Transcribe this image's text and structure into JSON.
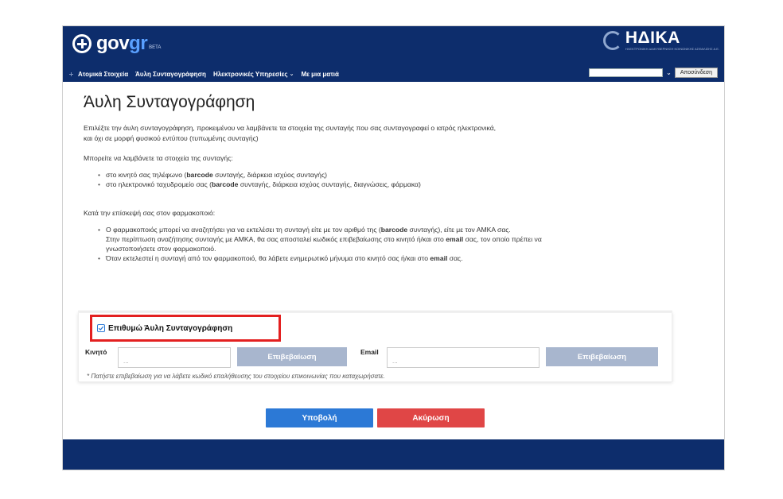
{
  "header": {
    "logo_main": "gov",
    "logo_accent": "gr",
    "logo_beta": "BETA",
    "partner_name": "ΗΔΙΚΑ",
    "partner_sub": "ΗΛΕΚΤΡΟΝΙΚΗ ΔΙΑΚΥΒΕΡΝΗΣΗ ΚΟΙΝΩΝΙΚΗΣ ΑΣΦΑΛΙΣΗΣ Α.Ε.",
    "nav": [
      "Ατομικά Στοιχεία",
      "Άυλη Συνταγογράφηση",
      "Ηλεκτρονικές Υπηρεσίες",
      "Με μια ματιά"
    ],
    "logout_label": "Αποσύνδεση"
  },
  "main": {
    "title": "Άυλη Συνταγογράφηση",
    "intro_1": "Επιλέξτε την άυλη συνταγογράφηση, προκειμένου να λαμβάνετε τα στοιχεία της συνταγής που σας συνταγογραφεί ο ιατρός ηλεκτρονικά,",
    "intro_2": "και όχι σε μορφή φυσικού εντύπου (τυπωμένης συνταγής)",
    "receive_title": "Μπορείτε να λαμβάνετε τα στοιχεία της συνταγής:",
    "receive_1_pre": "στο κινητό σας τηλέφωνο (",
    "receive_1_bold": "barcode",
    "receive_1_post": " συνταγής, διάρκεια ισχύος συνταγής)",
    "receive_2_pre": "στο ηλεκτρονικό ταχυδρομείο σας (",
    "receive_2_bold": "barcode",
    "receive_2_post": " συνταγής, διάρκεια ισχύος συνταγής, διαγνώσεις, φάρμακα)",
    "visit_title": "Κατά την επίσκεψή σας στον φαρμακοποιό:",
    "visit_1_pre": "Ο φαρμακοποιός μπορεί να αναζητήσει για να εκτελέσει τη συνταγή είτε με τον αριθμό της (",
    "visit_1_bold": "barcode",
    "visit_1_post": " συνταγής), είτε με τον ΑΜΚΑ σας.",
    "visit_1b_pre": "Στην περίπτωση αναζήτησης συνταγής με ΑΜΚΑ, θα σας αποσταλεί κωδικός επιβεβαίωσης στο κινητό ή/και στο ",
    "visit_1b_bold": "email",
    "visit_1b_post": " σας, τον οποίο πρέπει να",
    "visit_1c": "γνωστοποιήσετε στον φαρμακοποιό.",
    "visit_2_pre": "Όταν εκτελεστεί η συνταγή από τον φαρμακοποιό, θα λάβετε ενημερωτικό μήνυμα στο κινητό σας ή/και στο ",
    "visit_2_bold": "email",
    "visit_2_post": " σας."
  },
  "form": {
    "checkbox_label": "Επιθυμώ Άυλη Συνταγογράφηση",
    "checkbox_checked": true,
    "mobile_label": "Κινητό",
    "mobile_placeholder": "...",
    "email_label": "Email",
    "email_placeholder": "...",
    "confirm_label": "Επιβεβαίωση",
    "hint": "* Πατήστε επιβεβαίωση για να λάβετε κωδικό επαλήθευσης του στοιχείου επικοινωνίας που καταχωρήσατε."
  },
  "actions": {
    "submit_label": "Υποβολή",
    "cancel_label": "Ακύρωση"
  },
  "colors": {
    "header_bg": "#0d2d6c",
    "submit": "#2c79d6",
    "cancel": "#e04646",
    "confirm": "#a8b6ce",
    "highlight": "#e32020"
  }
}
